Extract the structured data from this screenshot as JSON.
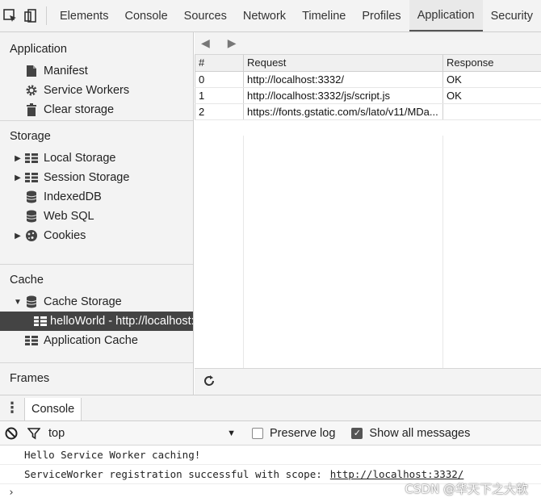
{
  "toolbar": {
    "tabs": [
      "Elements",
      "Console",
      "Sources",
      "Network",
      "Timeline",
      "Profiles",
      "Application",
      "Security"
    ],
    "active_tab": "Application"
  },
  "sidebar": {
    "application": {
      "title": "Application",
      "items": [
        "Manifest",
        "Service Workers",
        "Clear storage"
      ]
    },
    "storage": {
      "title": "Storage",
      "items": [
        "Local Storage",
        "Session Storage",
        "IndexedDB",
        "Web SQL",
        "Cookies"
      ]
    },
    "cache": {
      "title": "Cache",
      "items": [
        "Cache Storage",
        "helloWorld - http://localhost:",
        "Application Cache"
      ]
    },
    "frames": {
      "title": "Frames"
    }
  },
  "main": {
    "columns": [
      "#",
      "Request",
      "Response"
    ],
    "rows": [
      {
        "idx": "0",
        "request": "http://localhost:3332/",
        "response": "OK"
      },
      {
        "idx": "1",
        "request": "http://localhost:3332/js/script.js",
        "response": "OK"
      },
      {
        "idx": "2",
        "request": "https://fonts.gstatic.com/s/lato/v11/MDa...",
        "response": ""
      }
    ]
  },
  "drawer": {
    "tab": "Console"
  },
  "console": {
    "context": "top",
    "preserve_log": "Preserve log",
    "show_all": "Show all messages",
    "messages": [
      {
        "text": "Hello Service Worker caching!",
        "link": ""
      },
      {
        "text": "ServiceWorker registration successful with scope:",
        "link": "http://localhost:3332/"
      }
    ],
    "prompt": "›"
  },
  "watermark": "CSDN @华天下之大软"
}
